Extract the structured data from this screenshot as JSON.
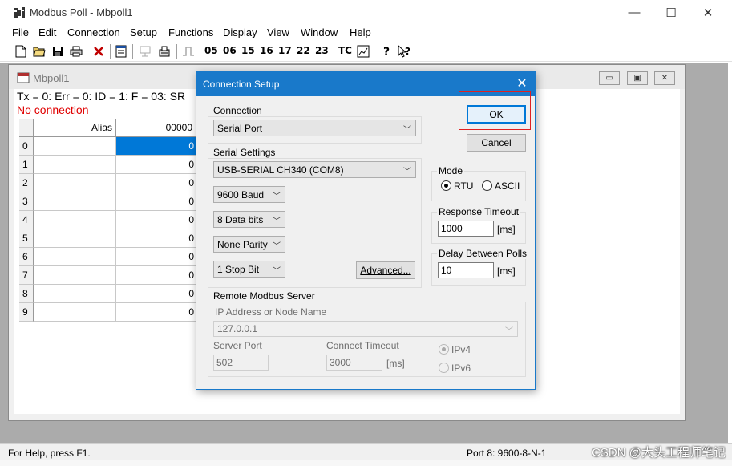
{
  "window": {
    "title": "Modbus Poll - Mbpoll1",
    "minimize": "—",
    "maximize": "☐",
    "close": "✕"
  },
  "menu": [
    "File",
    "Edit",
    "Connection",
    "Setup",
    "Functions",
    "Display",
    "View",
    "Window",
    "Help"
  ],
  "toolbar": {
    "function_codes": [
      "05",
      "06",
      "15",
      "16",
      "17",
      "22",
      "23"
    ],
    "tc_label": "TC"
  },
  "child": {
    "title": "Mbpoll1",
    "status_line": "Tx = 0: Err = 0: ID = 1: F = 03: SR",
    "connection_status": "No connection",
    "grid": {
      "alias_header": "Alias",
      "value_header": "00000",
      "rows": [
        {
          "index": "0",
          "value": "0"
        },
        {
          "index": "1",
          "value": "0"
        },
        {
          "index": "2",
          "value": "0"
        },
        {
          "index": "3",
          "value": "0"
        },
        {
          "index": "4",
          "value": "0"
        },
        {
          "index": "5",
          "value": "0"
        },
        {
          "index": "6",
          "value": "0"
        },
        {
          "index": "7",
          "value": "0"
        },
        {
          "index": "8",
          "value": "0"
        },
        {
          "index": "9",
          "value": "0"
        }
      ]
    }
  },
  "statusbar": {
    "help": "For Help, press F1.",
    "port": "Port 8: 9600-8-N-1",
    "watermark": "CSDN @大头工程师笔记"
  },
  "dialog": {
    "title": "Connection Setup",
    "close": "✕",
    "connection_group": "Connection",
    "connection_value": "Serial Port",
    "serial_group": "Serial Settings",
    "serial_port": "USB-SERIAL CH340 (COM8)",
    "baud": "9600 Baud",
    "data_bits": "8 Data bits",
    "parity": "None Parity",
    "stop_bits": "1 Stop Bit",
    "advanced": "Advanced...",
    "ok": "OK",
    "cancel": "Cancel",
    "mode_group": "Mode",
    "mode_rtu": "RTU",
    "mode_ascii": "ASCII",
    "mode_selected": "RTU",
    "response_timeout_group": "Response Timeout",
    "response_timeout": "1000",
    "response_unit": "[ms]",
    "delay_group": "Delay Between Polls",
    "delay": "10",
    "delay_unit": "[ms]",
    "remote_group": "Remote Modbus Server",
    "ip_label": "IP Address or Node Name",
    "ip_value": "127.0.0.1",
    "server_port_label": "Server Port",
    "server_port": "502",
    "connect_timeout_label": "Connect Timeout",
    "connect_timeout": "3000",
    "connect_timeout_unit": "[ms]",
    "ipv4": "IPv4",
    "ipv6": "IPv6"
  }
}
